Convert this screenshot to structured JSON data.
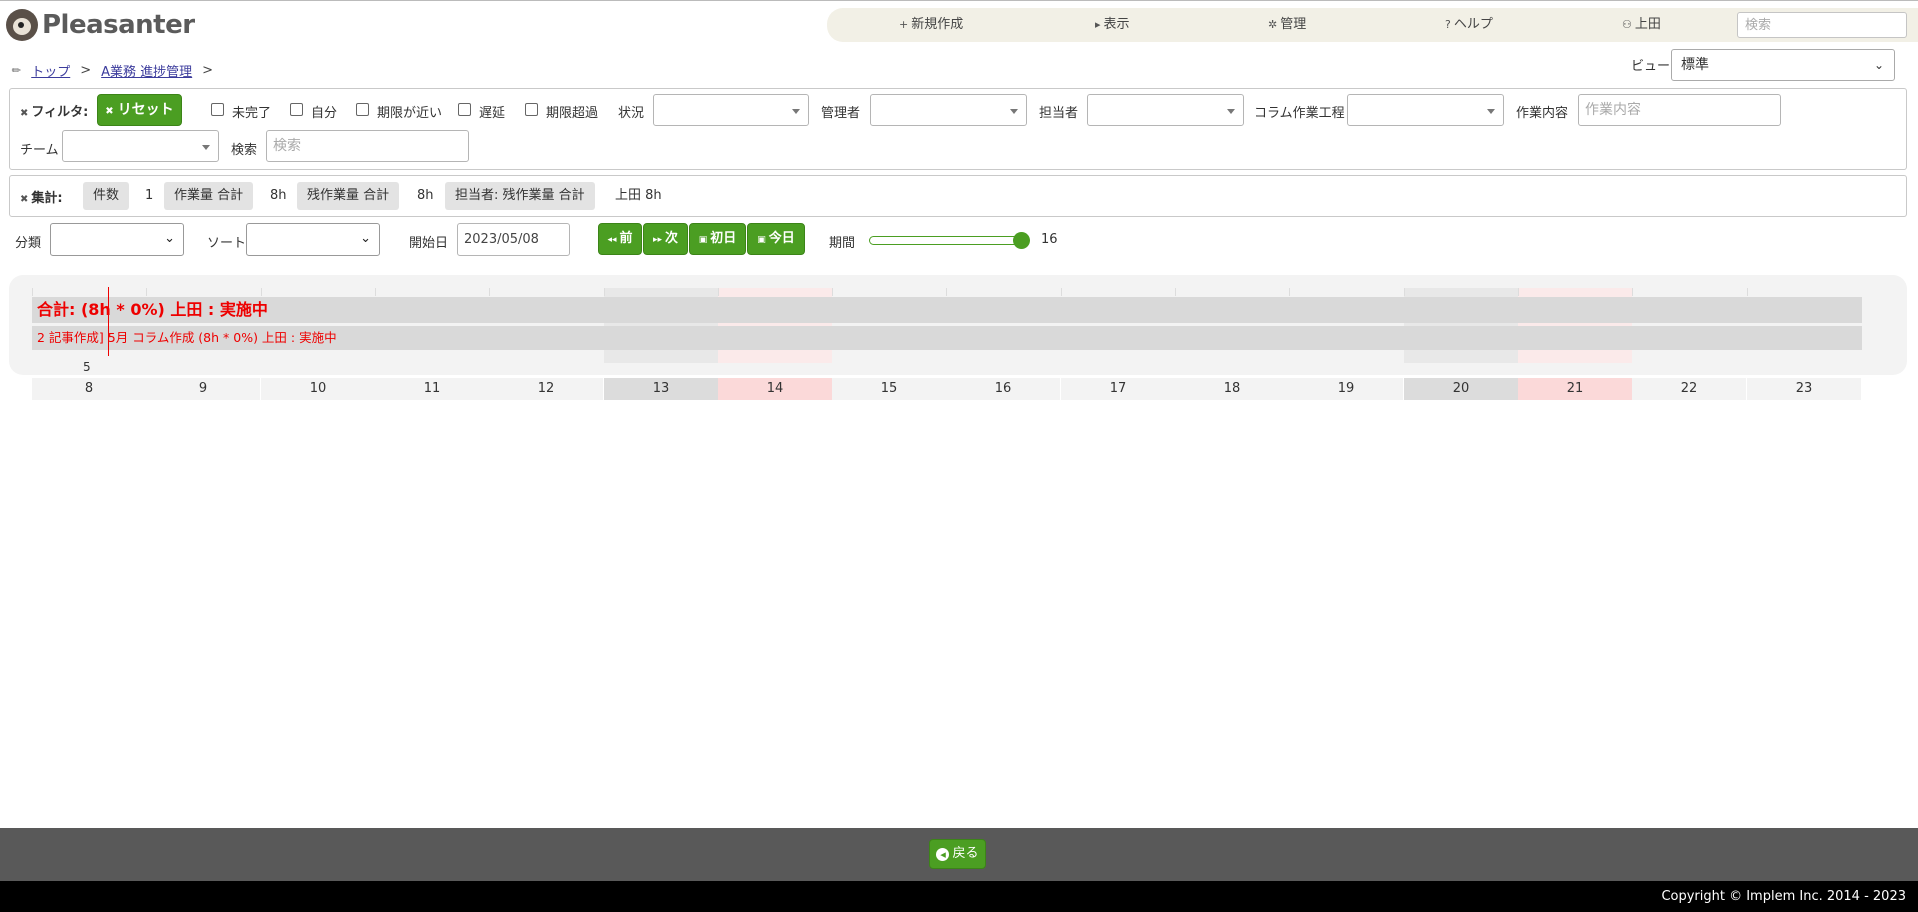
{
  "app": {
    "logo_text": "Pleasanter"
  },
  "topnav": {
    "new": "新規作成",
    "view": "表示",
    "manage": "管理",
    "help": "ヘルプ",
    "user": "上田",
    "search_placeholder": "検索"
  },
  "breadcrumb": {
    "top": "トップ",
    "site": "A業務 進捗管理",
    "sep": ">"
  },
  "view": {
    "label": "ビュー",
    "selected": "標準"
  },
  "filter": {
    "title": "フィルタ:",
    "reset": "リセット",
    "incomplete": "未完了",
    "self": "自分",
    "near_deadline": "期限が近い",
    "delay": "遅延",
    "overdue": "期限超過",
    "status": "状況",
    "manager": "管理者",
    "owner": "担当者",
    "column_process": "コラム作業工程",
    "work_content": "作業内容",
    "work_content_placeholder": "作業内容",
    "team": "チーム",
    "search": "検索",
    "search_placeholder": "検索"
  },
  "aggregation": {
    "title": "集計:",
    "count_label": "件数",
    "count_value": "1",
    "work_total_label": "作業量 合計",
    "work_total_value": "8h",
    "remaining_total_label": "残作業量 合計",
    "remaining_total_value": "8h",
    "owner_remaining_label": "担当者: 残作業量 合計",
    "owner_remaining_value": "上田 8h"
  },
  "controls": {
    "classification": "分類",
    "sort": "ソート",
    "start_date_label": "開始日",
    "start_date": "2023/05/08",
    "prev": "前",
    "next": "次",
    "first_day": "初日",
    "today": "今日",
    "period_label": "期間",
    "period_value": "16",
    "period_fraction": 1.0
  },
  "gantt": {
    "summary": "合計: (8h * 0%) 上田 : 実施中",
    "row": "2 記事作成]  5月 コラム作成 (8h * 0%) 上田 : 実施中",
    "month": "5",
    "days": [
      "8",
      "9",
      "10",
      "11",
      "12",
      "13",
      "14",
      "15",
      "16",
      "17",
      "18",
      "19",
      "20",
      "21",
      "22",
      "23"
    ],
    "day_kinds": [
      "",
      "",
      "",
      "",
      "",
      "sat",
      "sun",
      "",
      "",
      "",
      "",
      "",
      "sat",
      "sun",
      "",
      ""
    ]
  },
  "footer": {
    "back": "戻る",
    "copyright": "Copyright © Implem Inc. 2014 - 2023"
  },
  "colors": {
    "accent": "#4b9e22",
    "alert": "#e00000",
    "footer": "#595959"
  }
}
